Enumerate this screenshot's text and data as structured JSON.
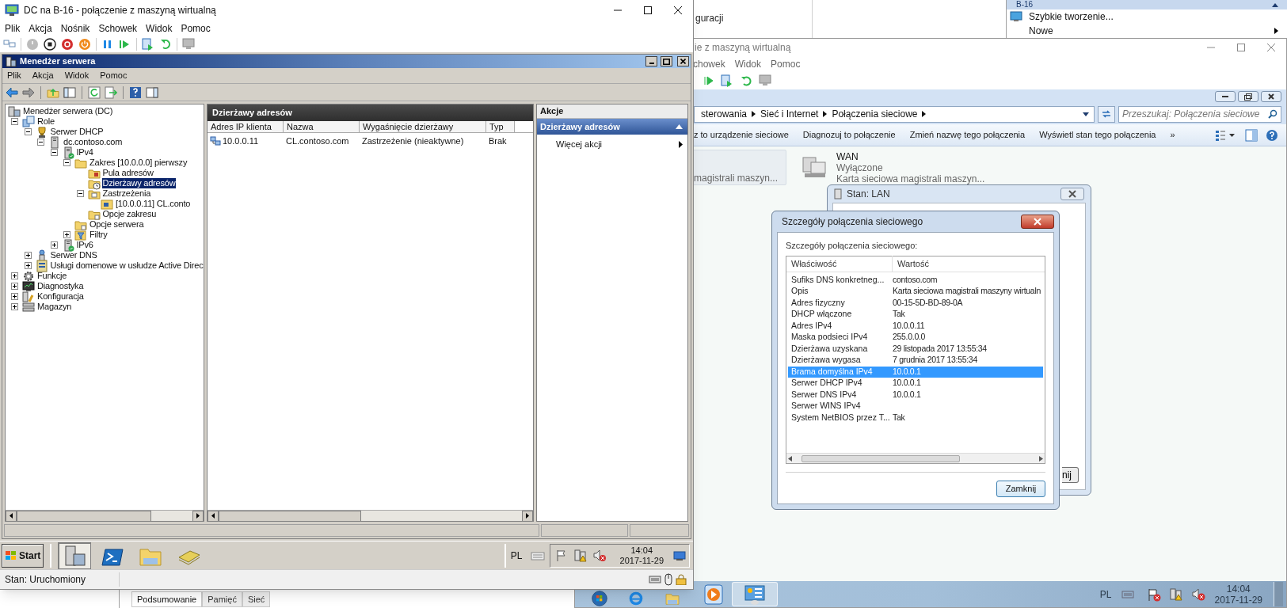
{
  "background_window": {
    "list_item": "guracji",
    "actions_header": "B-16",
    "actions": [
      {
        "label": "Szybkie tworzenie...",
        "kind": "command"
      },
      {
        "label": "Nowe",
        "kind": "submenu"
      }
    ],
    "tabs": [
      {
        "label": "Podsumowanie",
        "selected": true
      },
      {
        "label": "Pamięć",
        "selected": false
      },
      {
        "label": "Sieć",
        "selected": false
      }
    ]
  },
  "vm_left": {
    "title": "DC na B-16 - połączenie z maszyną wirtualną",
    "menu": [
      "Plik",
      "Akcja",
      "Nośnik",
      "Schowek",
      "Widok",
      "Pomoc"
    ],
    "server_manager": {
      "title": "Menedżer serwera",
      "menu": [
        "Plik",
        "Akcja",
        "Widok",
        "Pomoc"
      ],
      "tree": [
        {
          "label": "Menedżer serwera (DC)",
          "kind": "computer",
          "selected": false,
          "children": [
            {
              "label": "Role",
              "kind": "roles",
              "expanded": true,
              "selected": false,
              "children": [
                {
                  "label": "Serwer DHCP",
                  "kind": "dhcp",
                  "expanded": true,
                  "selected": false,
                  "children": [
                    {
                      "label": "dc.contoso.com",
                      "kind": "server",
                      "expanded": true,
                      "selected": false,
                      "children": [
                        {
                          "label": "IPv4",
                          "kind": "ip",
                          "expanded": true,
                          "selected": false,
                          "children": [
                            {
                              "label": "Zakres [10.0.0.0] pierwszy",
                              "kind": "folder",
                              "expanded": true,
                              "selected": false,
                              "children": [
                                {
                                  "label": "Pula adresów",
                                  "kind": "pool",
                                  "selected": false
                                },
                                {
                                  "label": "Dzierżawy adresów",
                                  "kind": "leases",
                                  "selected": true
                                },
                                {
                                  "label": "Zastrzeżenia",
                                  "kind": "reservations",
                                  "expanded": true,
                                  "selected": false,
                                  "children": [
                                    {
                                      "label": "[10.0.0.11] CL.conto",
                                      "kind": "reservation",
                                      "selected": false
                                    }
                                  ]
                                },
                                {
                                  "label": "Opcje zakresu",
                                  "kind": "options",
                                  "selected": false
                                }
                              ]
                            },
                            {
                              "label": "Opcje serwera",
                              "kind": "options",
                              "selected": false
                            },
                            {
                              "label": "Filtry",
                              "kind": "filters",
                              "expanded": false,
                              "selected": false
                            }
                          ]
                        },
                        {
                          "label": "IPv6",
                          "kind": "ip",
                          "expanded": false,
                          "selected": false
                        }
                      ]
                    }
                  ]
                },
                {
                  "label": "Serwer DNS",
                  "kind": "dns",
                  "expanded": false,
                  "selected": false
                },
                {
                  "label": "Usługi domenowe w usłudze Active Direc",
                  "kind": "ad",
                  "expanded": false,
                  "selected": false
                }
              ]
            },
            {
              "label": "Funkcje",
              "kind": "features",
              "expanded": false,
              "selected": false
            },
            {
              "label": "Diagnostyka",
              "kind": "diagnostics",
              "expanded": false,
              "selected": false
            },
            {
              "label": "Konfiguracja",
              "kind": "config",
              "expanded": false,
              "selected": false
            },
            {
              "label": "Magazyn",
              "kind": "storage",
              "expanded": false,
              "selected": false
            }
          ]
        }
      ],
      "center": {
        "header": "Dzierżawy adresów",
        "columns": [
          "Adres IP klienta",
          "Nazwa",
          "Wygaśnięcie dzierżawy",
          "Typ"
        ],
        "rows": [
          [
            "10.0.0.11",
            "CL.contoso.com",
            "Zastrzeżenie (nieaktywne)",
            "Brak"
          ]
        ]
      },
      "actions": {
        "header": "Akcje",
        "section": {
          "label": "Dzierżawy adresów",
          "expanded": true
        },
        "items": [
          {
            "label": "Więcej akcji",
            "kind": "submenu"
          }
        ]
      }
    },
    "taskbar": {
      "start": "Start",
      "apps": [
        {
          "kind": "server-manager",
          "selected": true
        },
        {
          "kind": "powershell",
          "selected": false
        },
        {
          "kind": "explorer",
          "selected": false
        },
        {
          "kind": "tool",
          "selected": false
        }
      ],
      "language": "PL",
      "time": "14:04",
      "date": "2017-11-29"
    },
    "status": "Stan: Uruchomiony"
  },
  "vm_right": {
    "title": "ie z maszyną wirtualną",
    "menu": [
      "chowek",
      "Widok",
      "Pomoc"
    ],
    "explorer": {
      "breadcrumb": [
        "sterowania",
        "Sieć i Internet",
        "Połączenia sieciowe"
      ],
      "search": {
        "placeholder": "Przeszukaj: Połączenia sieciowe"
      },
      "commands": [
        "z to urządzenie sieciowe",
        "Diagnozuj to połączenie",
        "Zmień nazwę tego połączenia",
        "Wyświetl stan tego połączenia",
        "»"
      ],
      "connections": [
        {
          "device": "magistrali maszyn...",
          "selected": true
        },
        {
          "name": "WAN",
          "status": "Wyłączone",
          "device": "Karta sieciowa magistrali maszyn...",
          "selected": false
        }
      ]
    },
    "status_dialog": {
      "title": "Stan: LAN",
      "button": "nij"
    },
    "details_dialog": {
      "title": "Szczegóły połączenia sieciowego",
      "label": "Szczegóły połączenia sieciowego:",
      "columns": [
        "Właściwość",
        "Wartość"
      ],
      "rows": [
        {
          "property": "Sufiks DNS konkretneg...",
          "value": "contoso.com",
          "selected": false
        },
        {
          "property": "Opis",
          "value": "Karta sieciowa magistrali maszyny wirtualn",
          "selected": false
        },
        {
          "property": "Adres fizyczny",
          "value": "00-15-5D-BD-89-0A",
          "selected": false
        },
        {
          "property": "DHCP włączone",
          "value": "Tak",
          "selected": false
        },
        {
          "property": "Adres IPv4",
          "value": "10.0.0.11",
          "selected": false
        },
        {
          "property": "Maska podsieci IPv4",
          "value": "255.0.0.0",
          "selected": false
        },
        {
          "property": "Dzierżawa uzyskana",
          "value": "29 listopada 2017 13:55:34",
          "selected": false
        },
        {
          "property": "Dzierżawa wygasa",
          "value": "7 grudnia 2017 13:55:34",
          "selected": false
        },
        {
          "property": "Brama domyślna IPv4",
          "value": "10.0.0.1",
          "selected": true
        },
        {
          "property": "Serwer DHCP IPv4",
          "value": "10.0.0.1",
          "selected": false
        },
        {
          "property": "Serwer DNS IPv4",
          "value": "10.0.0.1",
          "selected": false
        },
        {
          "property": "Serwer WINS IPv4",
          "selected": false
        },
        {
          "property": "System NetBIOS przez T...",
          "value": "Tak",
          "selected": false
        }
      ],
      "button": "Zamknij"
    },
    "taskbar": {
      "apps": [
        {
          "kind": "start",
          "selected": false
        },
        {
          "kind": "browser",
          "selected": false
        },
        {
          "kind": "explorer",
          "selected": false
        },
        {
          "kind": "media",
          "selected": false
        },
        {
          "kind": "control-panel",
          "selected": true
        }
      ],
      "language": "PL",
      "time": "14:04",
      "date": "2017-11-29"
    }
  }
}
